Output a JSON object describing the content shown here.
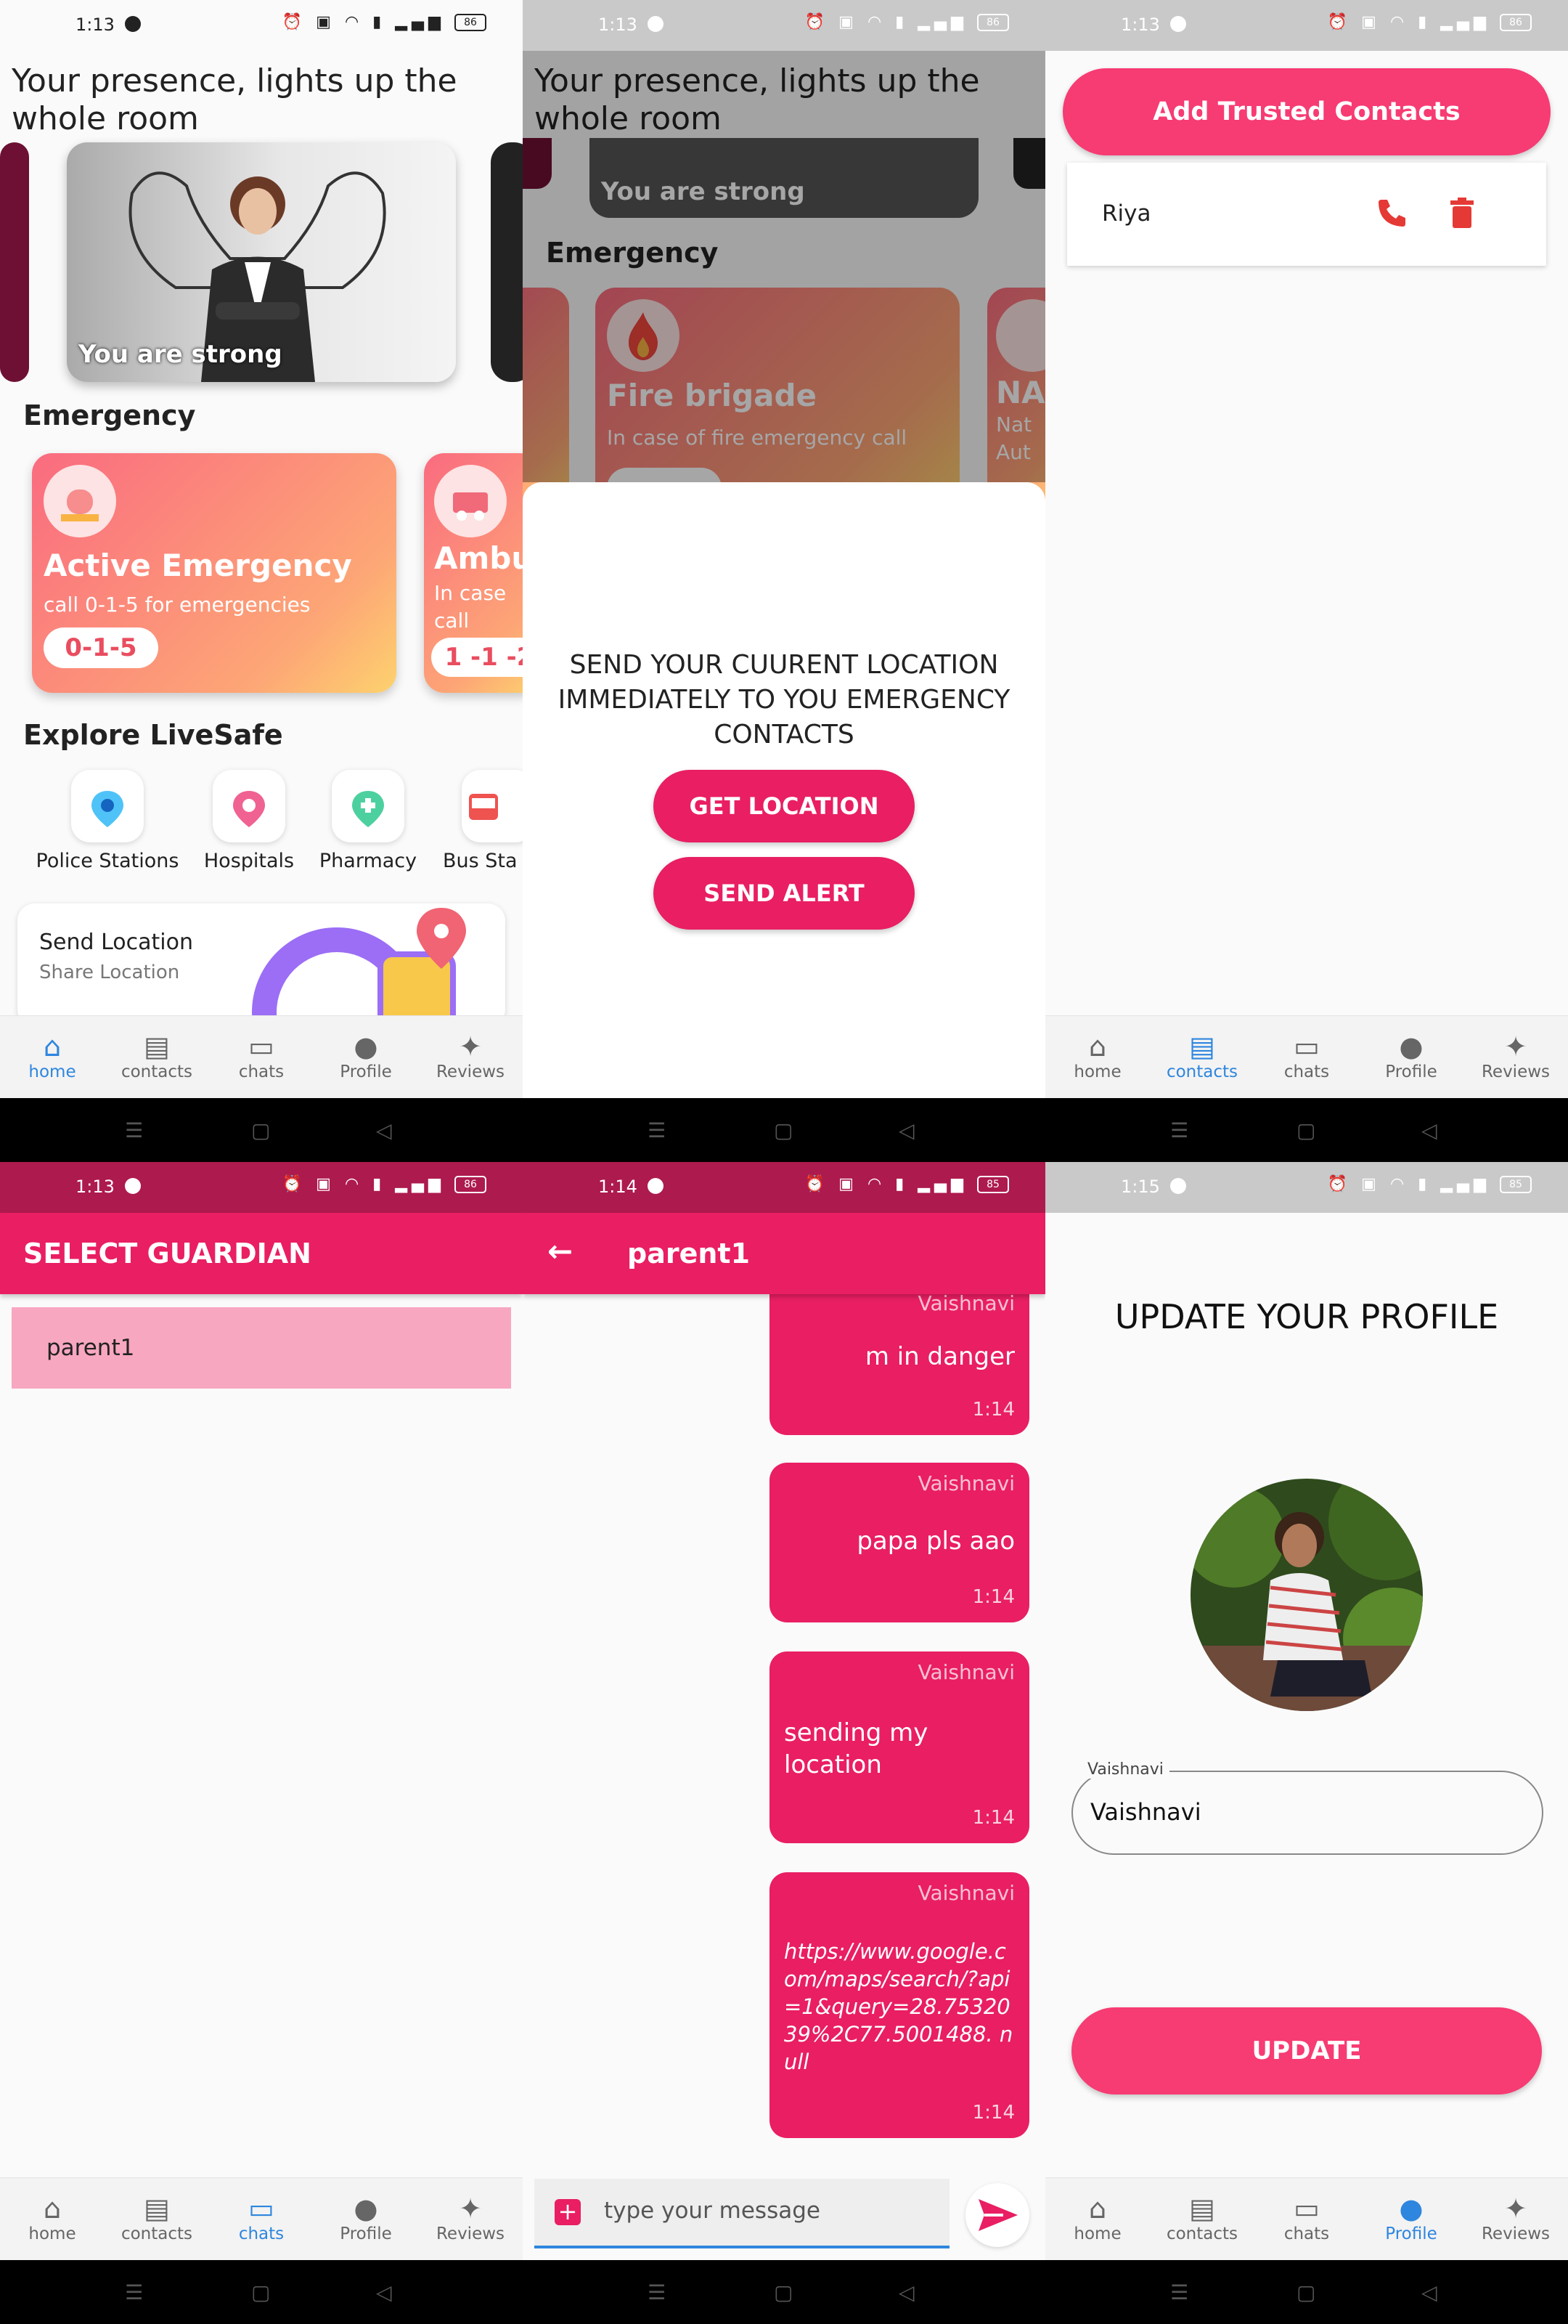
{
  "status": {
    "t1": "1:13",
    "t2": "1:13",
    "t3": "1:13",
    "t4": "1:13",
    "t5": "1:14",
    "t6": "1:15",
    "battery_a": "86",
    "battery_b": "85"
  },
  "nav": {
    "home": "home",
    "contacts": "contacts",
    "chats": "chats",
    "profile": "Profile",
    "reviews": "Reviews"
  },
  "home": {
    "quote": "Your presence, lights up the whole room",
    "hero_caption": "You are strong",
    "emergency_title": "Emergency",
    "active": {
      "title": "Active Emergency",
      "sub": "call 0-1-5 for emergencies",
      "number": "0-1-5"
    },
    "ambulance": {
      "title": "Ambu",
      "sub": "In case",
      "sub2": "call",
      "number": "1 -1 -2"
    },
    "explore_title": "Explore LiveSafe",
    "explore": [
      "Police Stations",
      "Hospitals",
      "Pharmacy",
      "Bus Sta"
    ],
    "send_location": {
      "title": "Send Location",
      "sub": "Share Location"
    }
  },
  "location": {
    "quote": "Your presence, lights up the whole room",
    "hero_caption": "You are strong",
    "emergency_title": "Emergency",
    "fire": {
      "title": "Fire brigade",
      "sub": "In case of fire emergency call"
    },
    "nat": {
      "title": "NA",
      "sub": "Nat",
      "sub2": "Aut"
    },
    "sheet_text": "SEND YOUR CUURENT LOCATION IMMEDIATELY TO YOU EMERGENCY CONTACTS",
    "get_location": "GET LOCATION",
    "send_alert": "SEND ALERT"
  },
  "contacts": {
    "add_button": "Add Trusted Contacts",
    "items": [
      {
        "name": "Riya"
      }
    ]
  },
  "guardian": {
    "title": "SELECT GUARDIAN",
    "items": [
      "parent1"
    ]
  },
  "chat": {
    "title": "parent1",
    "messages": [
      {
        "sender": "Vaishnavi",
        "text": "m in danger",
        "time": "1:14"
      },
      {
        "sender": "Vaishnavi",
        "text": "papa pls aao",
        "time": "1:14"
      },
      {
        "sender": "Vaishnavi",
        "text": "sending my location",
        "time": "1:14"
      },
      {
        "sender": "Vaishnavi",
        "text": "https://www.google.com/maps/search/?api=1&query=28.7532039%2C77.5001488. null",
        "time": "1:14"
      }
    ],
    "input_placeholder": "type your message"
  },
  "profile": {
    "title": "UPDATE YOUR PROFILE",
    "name_label": "Vaishnavi",
    "name_value": "Vaishnavi",
    "update_button": "UPDATE"
  },
  "colors": {
    "primary": "#e91e63",
    "accent_nav": "#2e86de",
    "add_button": "#f73b73",
    "delete": "#e53935"
  }
}
